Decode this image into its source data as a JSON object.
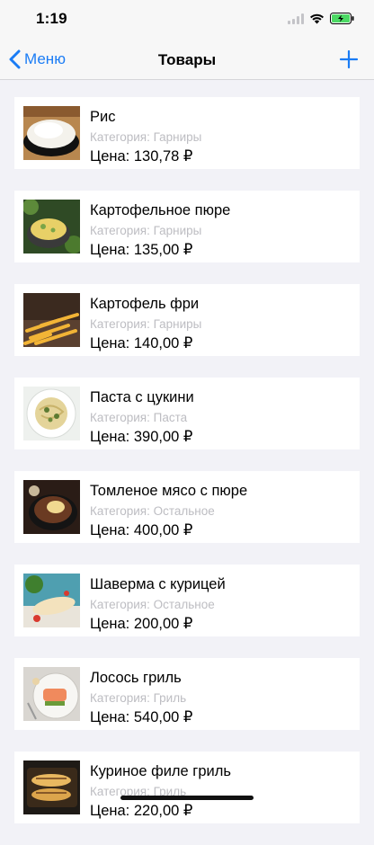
{
  "status_bar": {
    "time": "1:19",
    "battery_color": "#4cd964"
  },
  "nav": {
    "back_label": "Меню",
    "title": "Товары"
  },
  "accent_color": "#1a7cf5",
  "products": [
    {
      "name": "Рис",
      "category": "Категория: Гарниры",
      "price": "Цена: 130,78 ₽"
    },
    {
      "name": "Картофельное пюре",
      "category": "Категория: Гарниры",
      "price": "Цена: 135,00 ₽"
    },
    {
      "name": "Картофель фри",
      "category": "Категория: Гарниры",
      "price": "Цена: 140,00 ₽"
    },
    {
      "name": "Паста с цукини",
      "category": "Категория: Паста",
      "price": "Цена: 390,00 ₽"
    },
    {
      "name": "Томленое мясо с пюре",
      "category": "Категория: Остальное",
      "price": "Цена: 400,00 ₽"
    },
    {
      "name": "Шаверма с курицей",
      "category": "Категория: Остальное",
      "price": "Цена: 200,00 ₽"
    },
    {
      "name": "Лосось гриль",
      "category": "Категория: Гриль",
      "price": "Цена: 540,00 ₽"
    },
    {
      "name": "Куриное филе гриль",
      "category": "Категория: Гриль",
      "price": "Цена: 220,00 ₽"
    }
  ]
}
